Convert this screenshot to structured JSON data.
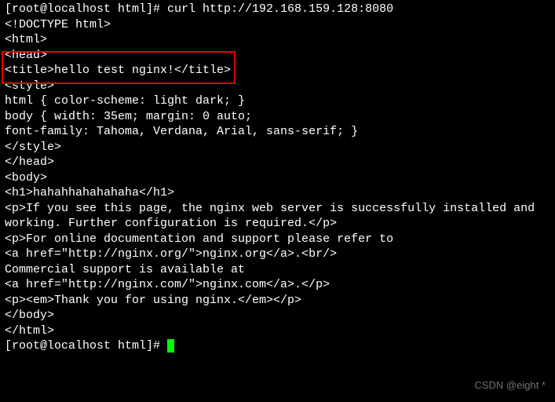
{
  "prompt1": "[root@localhost html]# curl http://192.168.159.128:8080",
  "out": {
    "l01": "<!DOCTYPE html>",
    "l02": "<html>",
    "l03": "<head>",
    "l04": "<title>hello test nginx!</title>",
    "l05": "<style>",
    "l06": "html { color-scheme: light dark; }",
    "l07": "body { width: 35em; margin: 0 auto;",
    "l08": "font-family: Tahoma, Verdana, Arial, sans-serif; }",
    "l09": "</style>",
    "l10": "</head>",
    "l11": "<body>",
    "l12": "<h1>hahahhahahahaha</h1>",
    "l13": "<p>If you see this page, the nginx web server is successfully installed and",
    "l14": "working. Further configuration is required.</p>",
    "l15": "",
    "l16": "<p>For online documentation and support please refer to",
    "l17": "<a href=\"http://nginx.org/\">nginx.org</a>.<br/>",
    "l18": "Commercial support is available at",
    "l19": "<a href=\"http://nginx.com/\">nginx.com</a>.</p>",
    "l20": "",
    "l21": "<p><em>Thank you for using nginx.</em></p>",
    "l22": "</body>",
    "l23": "</html>",
    "l24": ""
  },
  "prompt2": "[root@localhost html]# ",
  "watermark": "CSDN @eight   *"
}
